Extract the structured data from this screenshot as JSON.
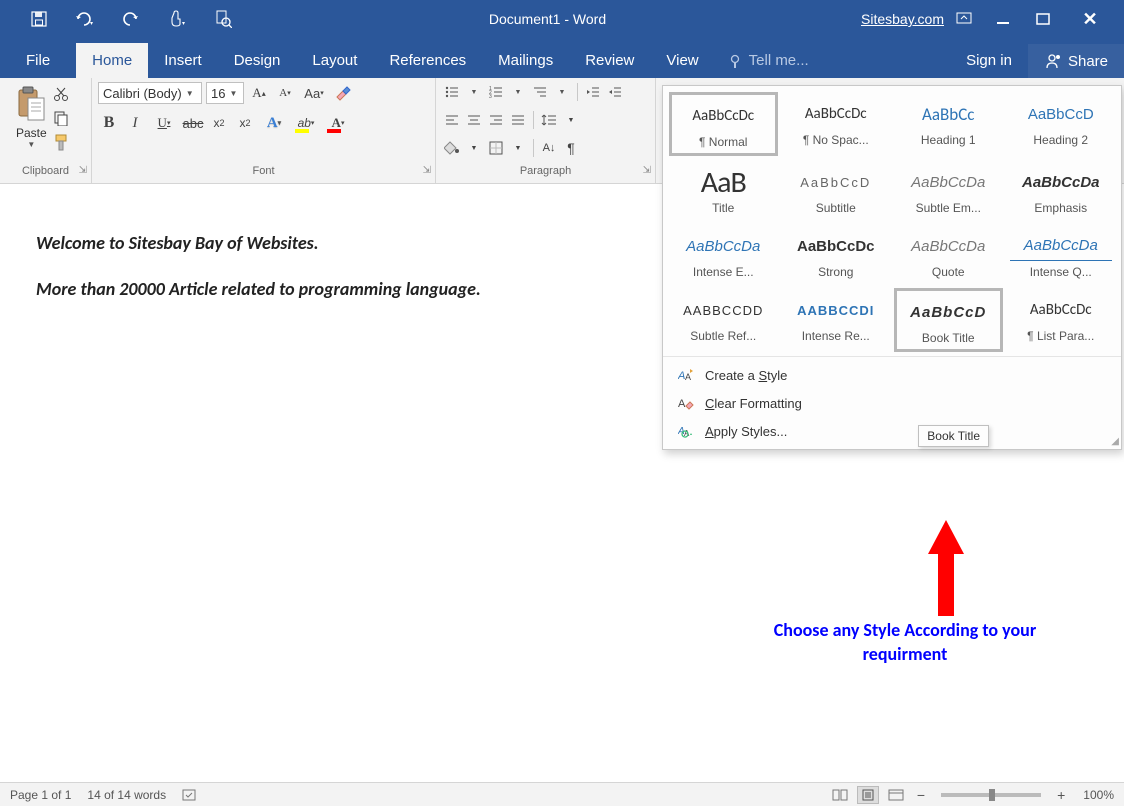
{
  "titlebar": {
    "title": "Document1 - Word",
    "site": "Sitesbay.com"
  },
  "tabs": {
    "file": "File",
    "home": "Home",
    "insert": "Insert",
    "design": "Design",
    "layout": "Layout",
    "references": "References",
    "mailings": "Mailings",
    "review": "Review",
    "view": "View",
    "tellme": "Tell me...",
    "signin": "Sign in",
    "share": "Share"
  },
  "ribbon": {
    "clipboard": {
      "paste": "Paste",
      "label": "Clipboard"
    },
    "font": {
      "name": "Calibri (Body)",
      "size": "16",
      "label": "Font"
    },
    "paragraph": {
      "label": "Paragraph"
    }
  },
  "styles": {
    "items": [
      {
        "preview": "AaBbCcDc",
        "name": "¶ Normal",
        "cls": "normal"
      },
      {
        "preview": "AaBbCcDc",
        "name": "¶ No Spac...",
        "cls": "normal"
      },
      {
        "preview": "AaBbCc",
        "name": "Heading 1",
        "cls": "heading"
      },
      {
        "preview": "AaBbCcD",
        "name": "Heading 2",
        "cls": "heading2"
      },
      {
        "preview": "AaB",
        "name": "Title",
        "cls": "title"
      },
      {
        "preview": "AaBbCcD",
        "name": "Subtitle",
        "cls": "subtitle"
      },
      {
        "preview": "AaBbCcDa",
        "name": "Subtle Em...",
        "cls": "subtle-em"
      },
      {
        "preview": "AaBbCcDa",
        "name": "Emphasis",
        "cls": "emphasis"
      },
      {
        "preview": "AaBbCcDa",
        "name": "Intense E...",
        "cls": "intense-e"
      },
      {
        "preview": "AaBbCcDc",
        "name": "Strong",
        "cls": "strong"
      },
      {
        "preview": "AaBbCcDa",
        "name": "Quote",
        "cls": "quote"
      },
      {
        "preview": "AaBbCcDa",
        "name": "Intense Q...",
        "cls": "intense-q"
      },
      {
        "preview": "AABBCCDD",
        "name": "Subtle Ref...",
        "cls": "subtle-ref"
      },
      {
        "preview": "AABBCCDI",
        "name": "Intense Re...",
        "cls": "intense-ref"
      },
      {
        "preview": "AaBbCcD",
        "name": "Book Title",
        "cls": "book-title"
      },
      {
        "preview": "AaBbCcDc",
        "name": "¶ List Para...",
        "cls": "normal"
      }
    ],
    "menu": {
      "create": "Create a ",
      "create_u": "S",
      "create2": "tyle",
      "clear_u": "C",
      "clear": "lear Formatting",
      "apply_u": "A",
      "apply": "pply Styles..."
    },
    "tooltip": "Book Title"
  },
  "document": {
    "line1": "Welcome to Sitesbay Bay of Websites.",
    "line2": "More than 20000 Article related to programming language."
  },
  "annotation": {
    "text": "Choose any Style According to your requirment"
  },
  "statusbar": {
    "page": "Page 1 of 1",
    "words": "14 of 14 words",
    "zoom": "100%"
  }
}
